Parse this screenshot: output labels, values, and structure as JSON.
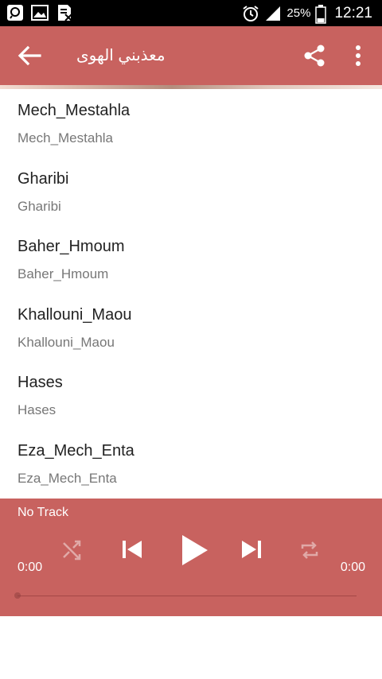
{
  "status_bar": {
    "battery_percent": "25%",
    "time": "12:21"
  },
  "app_bar": {
    "title": "معذبني الهوى",
    "back_icon": "arrow-back-icon",
    "share_icon": "share-icon",
    "more_icon": "more-vert-icon"
  },
  "tracks": [
    {
      "title": "Mech_Mestahla",
      "subtitle": "Mech_Mestahla"
    },
    {
      "title": "Gharibi",
      "subtitle": "Gharibi"
    },
    {
      "title": "Baher_Hmoum",
      "subtitle": "Baher_Hmoum"
    },
    {
      "title": "Khallouni_Maou",
      "subtitle": "Khallouni_Maou"
    },
    {
      "title": "Hases",
      "subtitle": "Hases"
    },
    {
      "title": "Eza_Mech_Enta",
      "subtitle": "Eza_Mech_Enta"
    }
  ],
  "player": {
    "now_playing": "No Track",
    "elapsed": "0:00",
    "total": "0:00",
    "progress": 0,
    "colors": {
      "panel": "#c8625f"
    }
  }
}
